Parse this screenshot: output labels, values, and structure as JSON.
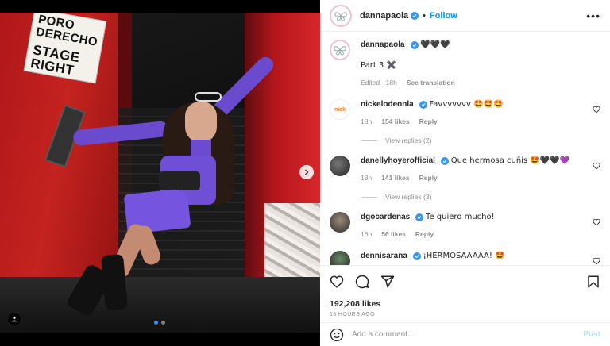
{
  "media": {
    "sign_line1": "PORO DERECHO",
    "sign_line2": "STAGE RIGHT",
    "carousel": {
      "total": 2,
      "current": 1
    }
  },
  "header": {
    "username": "dannapaola",
    "separator": "•",
    "follow_label": "Follow",
    "more_label": "•••"
  },
  "caption": {
    "username": "dannapaola",
    "emoji_title": "🖤🖤🖤",
    "text": "Part 3 ✖️",
    "edited": "Edited · 18h",
    "see_translation": "See translation"
  },
  "comments": [
    {
      "username": "nickelodeonla",
      "avatar_text": "nick",
      "text": "Favvvvvvv 🤩🤩🤩",
      "time": "18h",
      "likes": "154 likes",
      "reply": "Reply",
      "view_replies": "View replies (2)"
    },
    {
      "username": "danellyhoyerofficial",
      "text": "Que hermosa cuñis 🤩🖤🖤💜",
      "time": "18h",
      "likes": "141 likes",
      "reply": "Reply",
      "view_replies": "View replies (3)"
    },
    {
      "username": "dgocardenas",
      "text": "Te quiero mucho!",
      "time": "16h",
      "likes": "56 likes",
      "reply": "Reply"
    },
    {
      "username": "dennisarana",
      "text": "¡HERMOSAAAAA! 🤩"
    }
  ],
  "actions": {
    "likes": "192,208 likes",
    "time": "18 HOURS AGO"
  },
  "add_comment": {
    "placeholder": "Add a comment…",
    "post_label": "Post"
  },
  "colors": {
    "link_blue": "#0095f6",
    "verified_blue": "#3897f0",
    "post_disabled": "#b2dffc"
  }
}
